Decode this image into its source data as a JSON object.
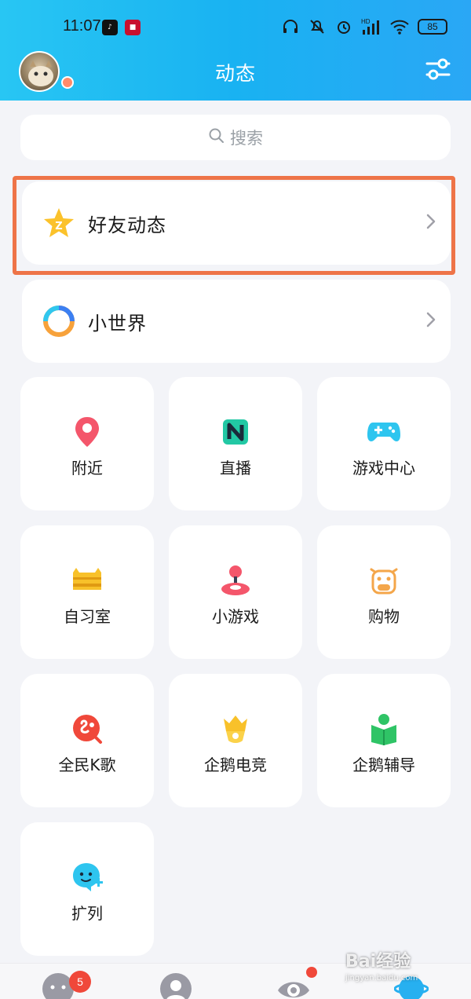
{
  "status_bar": {
    "time": "11:07",
    "battery": "85",
    "network_label": "HD",
    "tiktok_icon": "tiktok-icon",
    "app_icon": "news-app-icon"
  },
  "header": {
    "title": "动态",
    "avatar_icon": "user-avatar",
    "settings_icon": "sliders-icon",
    "colors": {
      "gradient_start": "#28c6f3",
      "gradient_end": "#2aa7f5"
    }
  },
  "search": {
    "placeholder": "搜索",
    "icon": "search-icon"
  },
  "list": [
    {
      "label": "好友动态",
      "icon": "qzone-star-icon",
      "highlighted": true,
      "highlight_color": "#ee7448"
    },
    {
      "label": "小世界",
      "icon": "small-world-ring-icon"
    }
  ],
  "grid": [
    {
      "label": "附近",
      "icon": "location-pin-icon",
      "color": "#f4566b"
    },
    {
      "label": "直播",
      "icon": "live-n-icon",
      "color": "#22c8a4"
    },
    {
      "label": "游戏中心",
      "icon": "gamepad-icon",
      "color": "#2ec5ef"
    },
    {
      "label": "自习室",
      "icon": "study-cat-icon",
      "color": "#f8c12a"
    },
    {
      "label": "小游戏",
      "icon": "joystick-icon",
      "color": "#f4566b"
    },
    {
      "label": "购物",
      "icon": "cow-face-icon",
      "color": "#f4a64a"
    },
    {
      "label": "全民K歌",
      "icon": "karaoke-icon",
      "color": "#f0483a"
    },
    {
      "label": "企鹅电竞",
      "icon": "esports-crown-icon",
      "color": "#f8c12a"
    },
    {
      "label": "企鹅辅导",
      "icon": "tutoring-book-icon",
      "color": "#2fc466"
    },
    {
      "label": "扩列",
      "icon": "add-friend-bubble-icon",
      "color": "#2ec5ef"
    }
  ],
  "bottom_nav": {
    "items": [
      {
        "icon": "messages-icon"
      },
      {
        "icon": "contacts-icon"
      },
      {
        "icon": "eye-icon"
      },
      {
        "icon": "planet-icon"
      }
    ],
    "badge_count": "5"
  },
  "watermark": {
    "text": "Bai经验",
    "sub": "jingyan.baidu.com"
  }
}
